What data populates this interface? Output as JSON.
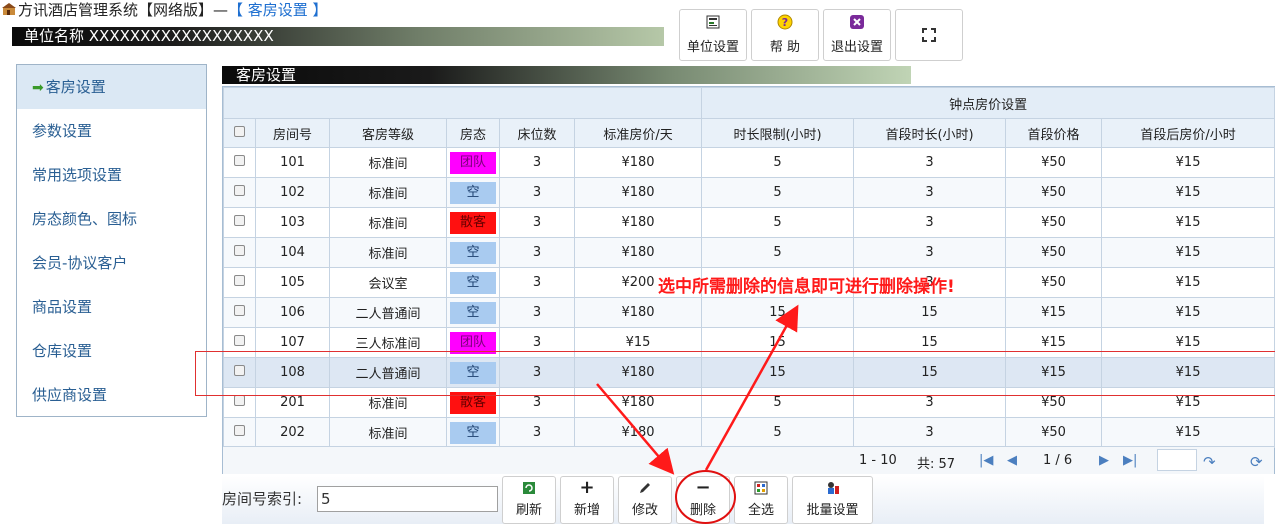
{
  "window": {
    "title": "方讯酒店管理系统【网络版】— ",
    "breadcrumb": "【 客房设置 】"
  },
  "unit_bar": {
    "label": "单位名称 XXXXXXXXXXXXXXXXXX"
  },
  "top_buttons": [
    {
      "label": "单位设置",
      "icon": "unit-settings-icon"
    },
    {
      "label": "帮 助",
      "icon": "help-icon"
    },
    {
      "label": "退出设置",
      "icon": "exit-icon"
    },
    {
      "label": "",
      "icon": "fullscreen-icon"
    }
  ],
  "sidebar": {
    "items": [
      {
        "label": "客房设置",
        "active": true
      },
      {
        "label": "参数设置"
      },
      {
        "label": "常用选项设置"
      },
      {
        "label": "房态颜色、图标"
      },
      {
        "label": "会员-协议客户"
      },
      {
        "label": "商品设置"
      },
      {
        "label": "仓库设置"
      },
      {
        "label": "供应商设置"
      }
    ]
  },
  "section": {
    "title": "客房设置"
  },
  "table": {
    "group_header": "钟点房价设置",
    "columns": [
      "房间号",
      "客房等级",
      "房态",
      "床位数",
      "标准房价/天",
      "时长限制(小时)",
      "首段时长(小时)",
      "首段价格",
      "首段后房价/小时"
    ],
    "rows": [
      {
        "room": "101",
        "grade": "标准间",
        "status": "团队",
        "status_type": "team",
        "beds": "3",
        "price": "¥180",
        "limit": "5",
        "first_len": "3",
        "first_price": "¥50",
        "after": "¥15"
      },
      {
        "room": "102",
        "grade": "标准间",
        "status": "空",
        "status_type": "empty",
        "beds": "3",
        "price": "¥180",
        "limit": "5",
        "first_len": "3",
        "first_price": "¥50",
        "after": "¥15"
      },
      {
        "room": "103",
        "grade": "标准间",
        "status": "散客",
        "status_type": "walkin",
        "beds": "3",
        "price": "¥180",
        "limit": "5",
        "first_len": "3",
        "first_price": "¥50",
        "after": "¥15"
      },
      {
        "room": "104",
        "grade": "标准间",
        "status": "空",
        "status_type": "empty",
        "beds": "3",
        "price": "¥180",
        "limit": "5",
        "first_len": "3",
        "first_price": "¥50",
        "after": "¥15"
      },
      {
        "room": "105",
        "grade": "会议室",
        "status": "空",
        "status_type": "empty",
        "beds": "3",
        "price": "¥200",
        "limit": "",
        "first_len": "3",
        "first_price": "¥50",
        "after": "¥15"
      },
      {
        "room": "106",
        "grade": "二人普通间",
        "status": "空",
        "status_type": "empty",
        "beds": "3",
        "price": "¥180",
        "limit": "15",
        "first_len": "15",
        "first_price": "¥15",
        "after": "¥15"
      },
      {
        "room": "107",
        "grade": "三人标准间",
        "status": "团队",
        "status_type": "team",
        "beds": "3",
        "price": "¥15",
        "limit": "15",
        "first_len": "15",
        "first_price": "¥15",
        "after": "¥15"
      },
      {
        "room": "108",
        "grade": "二人普通间",
        "status": "空",
        "status_type": "empty",
        "beds": "3",
        "price": "¥180",
        "limit": "15",
        "first_len": "15",
        "first_price": "¥15",
        "after": "¥15",
        "selected": true
      },
      {
        "room": "201",
        "grade": "标准间",
        "status": "散客",
        "status_type": "walkin",
        "beds": "3",
        "price": "¥180",
        "limit": "5",
        "first_len": "3",
        "first_price": "¥50",
        "after": "¥15"
      },
      {
        "room": "202",
        "grade": "标准间",
        "status": "空",
        "status_type": "empty",
        "beds": "3",
        "price": "¥180",
        "limit": "5",
        "first_len": "3",
        "first_price": "¥50",
        "after": "¥15"
      }
    ]
  },
  "pager": {
    "range": "1 - 10",
    "total": "共: 57",
    "page": "1 / 6"
  },
  "search": {
    "label": "房间号索引:",
    "value": "5"
  },
  "toolbar": [
    {
      "label": "刷新",
      "icon": "refresh-icon"
    },
    {
      "label": "新增",
      "icon": "plus-icon"
    },
    {
      "label": "修改",
      "icon": "pencil-icon"
    },
    {
      "label": "删除",
      "icon": "minus-icon"
    },
    {
      "label": "全选",
      "icon": "select-all-icon"
    },
    {
      "label": "批量设置",
      "icon": "batch-settings-icon"
    }
  ],
  "annotation": {
    "text": "选中所需删除的信息即可进行删除操作!",
    "color": "#ff1a1a"
  },
  "colors": {
    "status_team": "#ff00ff",
    "status_empty": "#a9cbf0",
    "status_walkin": "#ff1010",
    "link": "#2a5f93"
  }
}
